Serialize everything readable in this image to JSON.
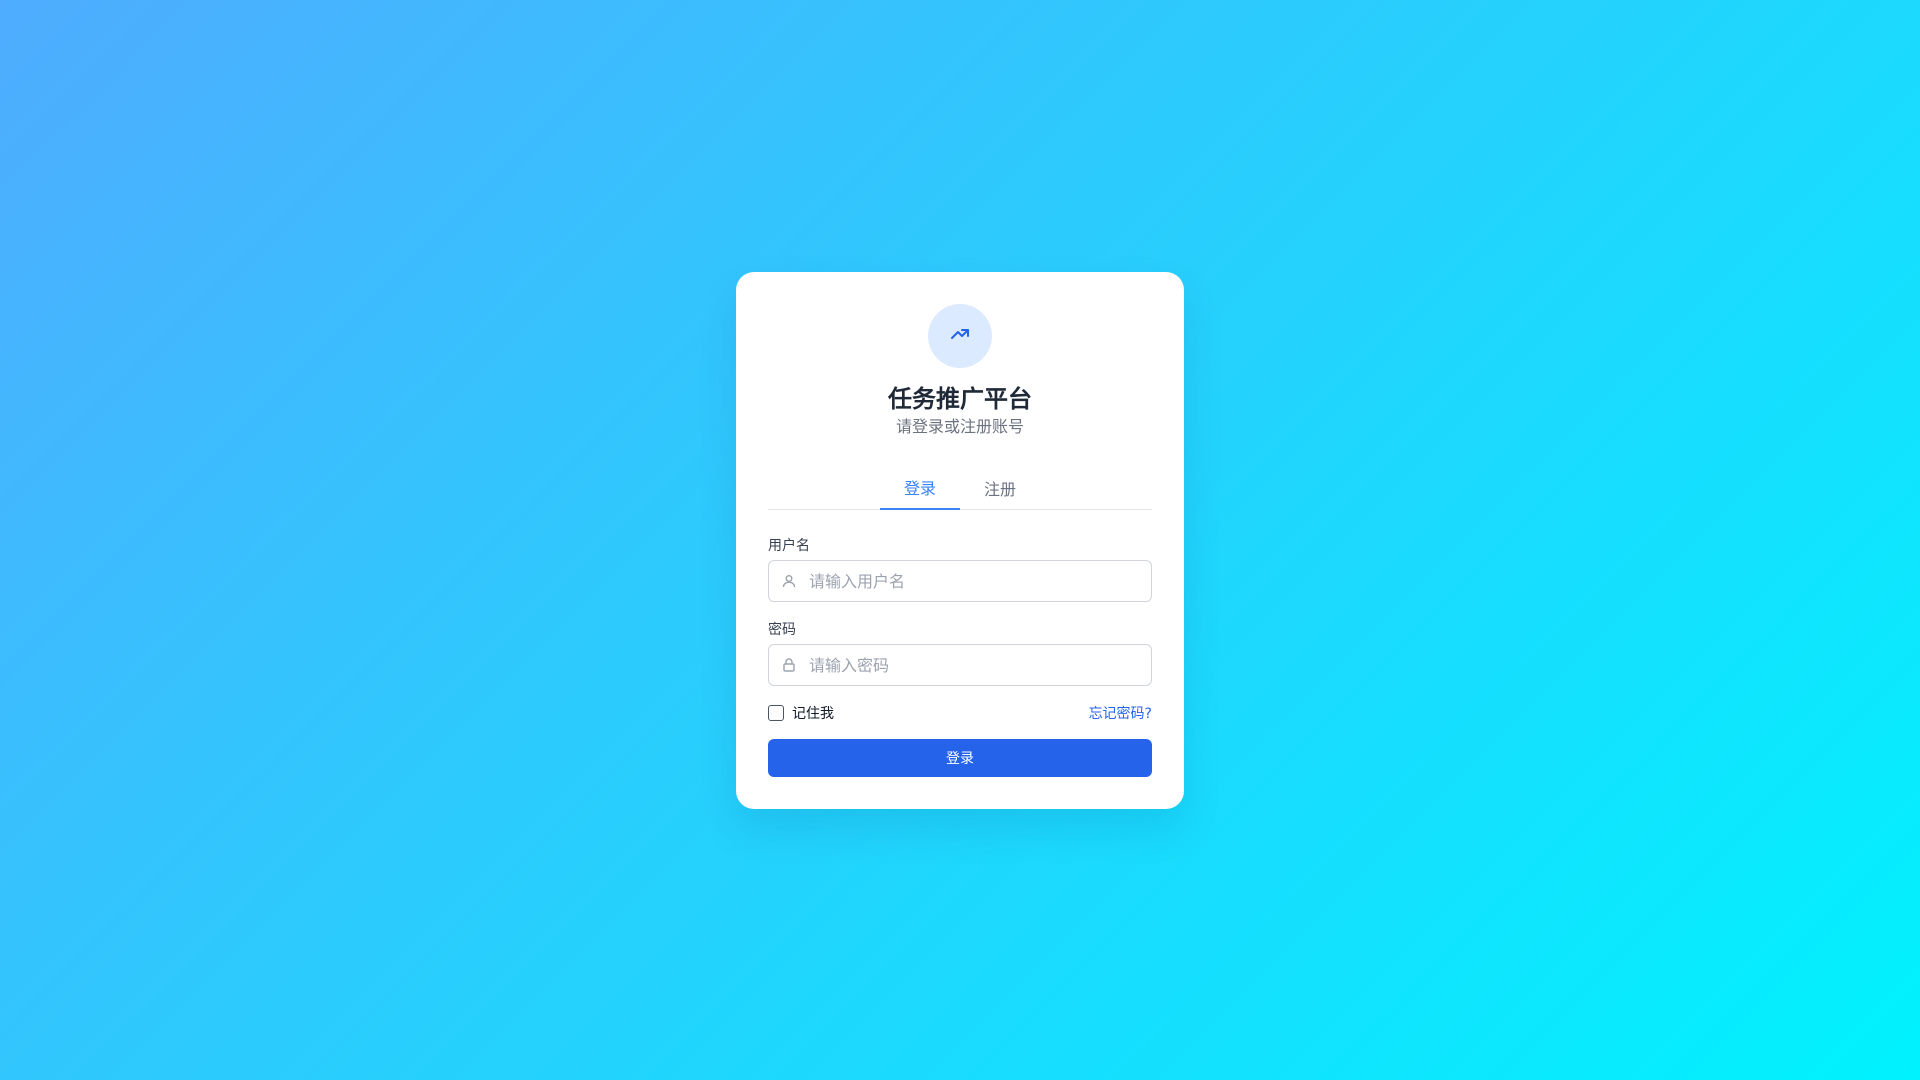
{
  "app": {
    "title": "任务推广平台",
    "subtitle": "请登录或注册账号",
    "logo_icon": "app-logo-icon"
  },
  "tabs": [
    {
      "label": "登录",
      "active": true
    },
    {
      "label": "注册",
      "active": false
    }
  ],
  "form": {
    "username": {
      "label": "用户名",
      "placeholder": "请输入用户名",
      "value": "",
      "icon": "user-icon"
    },
    "password": {
      "label": "密码",
      "placeholder": "请输入密码",
      "value": "",
      "icon": "lock-icon"
    },
    "remember_label": "记住我",
    "remember_checked": false,
    "forgot_label": "忘记密码?",
    "submit_label": "登录"
  },
  "colors": {
    "primary": "#2563eb",
    "tab_active": "#3b82f6",
    "background_start": "#4facfe",
    "background_end": "#00f2fe"
  }
}
